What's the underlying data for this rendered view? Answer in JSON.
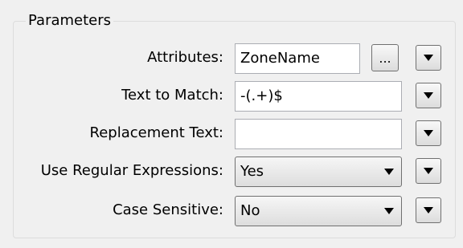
{
  "group": {
    "title": "Parameters"
  },
  "rows": {
    "attributes": {
      "label": "Attributes:",
      "value": "ZoneName",
      "browse_label": "..."
    },
    "text_to_match": {
      "label": "Text to Match:",
      "value": "-(.+)$"
    },
    "replacement_text": {
      "label": "Replacement Text:",
      "value": ""
    },
    "use_regex": {
      "label": "Use Regular Expressions:",
      "value": "Yes"
    },
    "case_sensitive": {
      "label": "Case Sensitive:",
      "value": "No"
    }
  }
}
